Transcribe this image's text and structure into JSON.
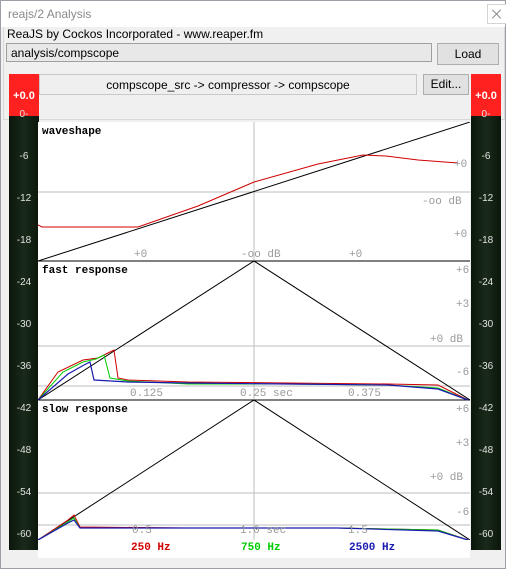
{
  "window": {
    "title": "reajs/2 Analysis"
  },
  "header": {
    "group_label": "ReaJS by Cockos Incorporated - www.reaper.fm",
    "path_value": "analysis/compscope",
    "load_label": "Load"
  },
  "chain": {
    "text": "compscope_src -> compressor -> compscope",
    "edit_label": "Edit..."
  },
  "meters": {
    "peak_label": "+0.0",
    "scale": [
      "0-",
      "-6",
      "-12",
      "-18",
      "-24",
      "-30",
      "-36",
      "-42",
      "-48",
      "-54",
      "-60"
    ]
  },
  "panels": {
    "waveshape": {
      "title": "waveshape",
      "labels": [
        "+0",
        "-oo dB",
        "-oo dB",
        "+0",
        "+0",
        "+0"
      ]
    },
    "fast": {
      "title": "fast response",
      "labels": [
        "+6",
        "+3",
        "+0 dB",
        "-6",
        "0.125",
        "0.25 sec",
        "0.375"
      ]
    },
    "slow": {
      "title": "slow response",
      "labels": [
        "+6",
        "+3",
        "+0 dB",
        "-6",
        "0.5",
        "1.0 sec",
        "1.5"
      ]
    }
  },
  "legend": [
    {
      "label": "250 Hz",
      "color": "#d00000"
    },
    {
      "label": "750 Hz",
      "color": "#00cc00"
    },
    {
      "label": "2500 Hz",
      "color": "#1a1ab0"
    }
  ]
}
